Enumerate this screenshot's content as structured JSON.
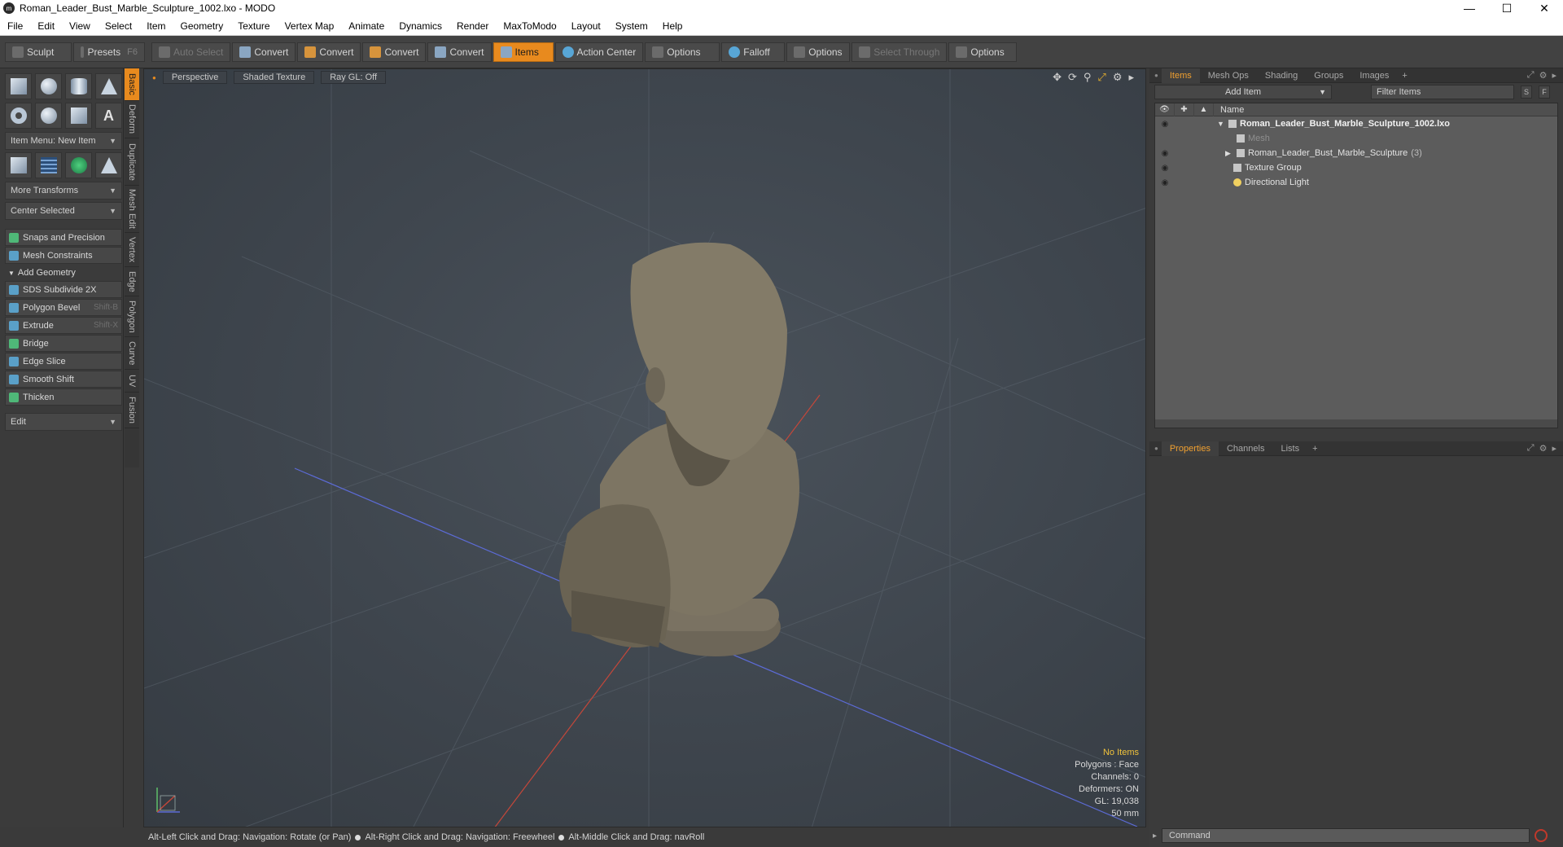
{
  "window": {
    "title": "Roman_Leader_Bust_Marble_Sculpture_1002.lxo - MODO",
    "app_icon": "modo-icon"
  },
  "menu": [
    "File",
    "Edit",
    "View",
    "Select",
    "Item",
    "Geometry",
    "Texture",
    "Vertex Map",
    "Animate",
    "Dynamics",
    "Render",
    "MaxToModo",
    "Layout",
    "System",
    "Help"
  ],
  "toolbar": {
    "sculpt": "Sculpt",
    "presets": "Presets",
    "presets_key": "F6",
    "auto_select": "Auto Select",
    "convert1": "Convert",
    "convert2": "Convert",
    "convert3": "Convert",
    "convert4": "Convert",
    "items": "Items",
    "action_center": "Action Center",
    "options1": "Options",
    "falloff": "Falloff",
    "options2": "Options",
    "select_through": "Select Through",
    "options3": "Options"
  },
  "left": {
    "item_menu": "Item Menu: New Item",
    "more_transforms": "More Transforms",
    "center_selected": "Center Selected",
    "snaps": "Snaps and Precision",
    "mesh_constraints": "Mesh Constraints",
    "add_geometry": "Add Geometry",
    "tools": [
      {
        "label": "SDS Subdivide 2X",
        "shortcut": ""
      },
      {
        "label": "Polygon Bevel",
        "shortcut": "Shift-B"
      },
      {
        "label": "Extrude",
        "shortcut": "Shift-X"
      },
      {
        "label": "Bridge",
        "shortcut": ""
      },
      {
        "label": "Edge Slice",
        "shortcut": ""
      },
      {
        "label": "Smooth Shift",
        "shortcut": ""
      },
      {
        "label": "Thicken",
        "shortcut": ""
      }
    ],
    "edit": "Edit"
  },
  "vtabs": [
    "Basic",
    "Deform",
    "Duplicate",
    "Mesh Edit",
    "Vertex",
    "Edge",
    "Polygon",
    "Curve",
    "UV",
    "Fusion"
  ],
  "viewport": {
    "perspective": "Perspective",
    "shading": "Shaded Texture",
    "raygl": "Ray GL: Off",
    "stats": {
      "items": "No Items",
      "polygons": "Polygons : Face",
      "channels": "Channels: 0",
      "deformers": "Deformers: ON",
      "gl": "GL: 19,038",
      "size": "50 mm"
    }
  },
  "items_panel": {
    "tabs": [
      "Items",
      "Mesh Ops",
      "Shading",
      "Groups",
      "Images"
    ],
    "add_item": "Add Item",
    "filter": "Filter Items",
    "btn_s": "S",
    "btn_f": "F",
    "col_name": "Name",
    "rows": {
      "root": "Roman_Leader_Bust_Marble_Sculpture_1002.lxo",
      "mesh": "Mesh",
      "group": "Roman_Leader_Bust_Marble_Sculpture",
      "group_count": "(3)",
      "texture": "Texture Group",
      "light": "Directional Light"
    }
  },
  "props_panel": {
    "tabs": [
      "Properties",
      "Channels",
      "Lists"
    ]
  },
  "status": {
    "hint1": "Alt-Left Click and Drag: Navigation: Rotate (or Pan)",
    "hint2": "Alt-Right Click and Drag: Navigation: Freewheel",
    "hint3": "Alt-Middle Click and Drag: navRoll"
  },
  "command": {
    "placeholder": "Command"
  },
  "colors": {
    "accent": "#e88a1e",
    "warning_text": "#f0c23b"
  }
}
